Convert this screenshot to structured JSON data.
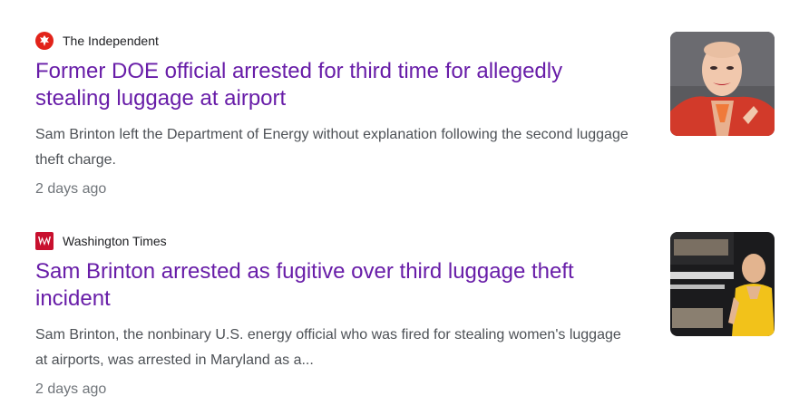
{
  "articles": [
    {
      "source": "The Independent",
      "favicon_icon": "independent-eagle-icon",
      "favicon_color": "#e2231a",
      "headline": "Former DOE official arrested for third time for allegedly stealing luggage at airport",
      "snippet": "Sam Brinton left the Department of Energy without explanation following the second luggage theft charge.",
      "time": "2 days ago",
      "thumbnail": "photo-person-red-jacket"
    },
    {
      "source": "Washington Times",
      "favicon_icon": "washington-times-w-icon",
      "favicon_color": "#c8102e",
      "headline": "Sam Brinton arrested as fugitive over third luggage theft incident",
      "snippet": "Sam Brinton, the nonbinary U.S. energy official who was fired for stealing women's luggage at airports, was arrested in Maryland as a...",
      "time": "2 days ago",
      "thumbnail": "photo-person-yellow-dress"
    }
  ],
  "colors": {
    "headline_visited": "#681da8",
    "snippet": "#4d5156",
    "time": "#70757a",
    "source": "#202124"
  }
}
